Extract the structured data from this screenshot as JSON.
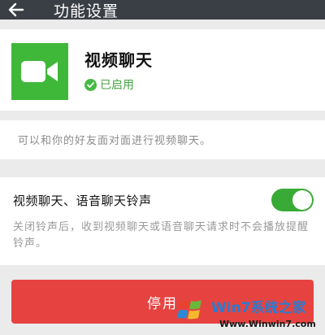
{
  "header": {
    "back_icon": "arrow-left-icon",
    "title": "功能设置"
  },
  "feature": {
    "icon": "video-camera-icon",
    "icon_bg": "#3fb83a",
    "name": "视频聊天",
    "status_icon": "check-circle-icon",
    "status": "已启用",
    "description": "可以和你的好友面对面进行视频聊天。"
  },
  "ringtone_setting": {
    "label": "视频聊天、语音聊天铃声",
    "enabled": true,
    "note": "关闭铃声后，收到视频聊天或语音聊天请求时不会播放提醒铃声。"
  },
  "actions": {
    "disable_label": "停用",
    "disable_color": "#e64340"
  },
  "watermark": {
    "title": "Win7系统之家",
    "url": "Www.Winwin7.com"
  }
}
